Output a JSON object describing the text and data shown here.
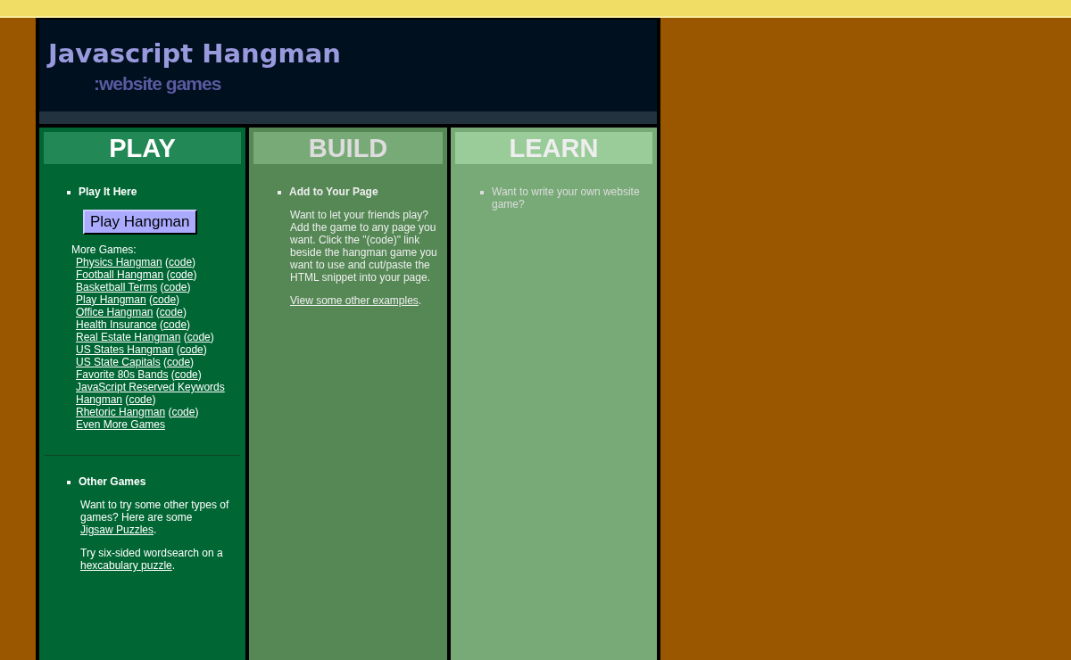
{
  "header": {
    "title": "Javascript Hangman",
    "subtitle": ":website games"
  },
  "play": {
    "heading": "PLAY",
    "section_title": "Play It Here",
    "button": "Play Hangman",
    "more_label": "More Games:",
    "games": [
      {
        "name": "Physics Hangman",
        "before_code": " (",
        "code": "code",
        "after_code": ")"
      },
      {
        "name": "Football Hangman",
        "before_code": " (",
        "code": "code",
        "after_code": ")"
      },
      {
        "name": "Basketball Terms",
        "before_code": " (",
        "code": "code",
        "after_code": ")"
      },
      {
        "name": "Play Hangman",
        "before_code": " (",
        "code": "code",
        "after_code": ")"
      },
      {
        "name": "Office Hangman",
        "before_code": " (",
        "code": "code",
        "after_code": ")"
      },
      {
        "name": "Health Insurance",
        "before_code": " (",
        "code": "code",
        "after_code": ")"
      },
      {
        "name": "Real Estate Hangman",
        "before_code": " (",
        "code": "code",
        "after_code": ")"
      },
      {
        "name": "US States Hangman",
        "before_code": " (",
        "code": "code",
        "after_code": ")"
      },
      {
        "name": "US State Capitals",
        "before_code": " (",
        "code": "code",
        "after_code": ")"
      },
      {
        "name": "Favorite 80s Bands",
        "before_code": " (",
        "code": "code",
        "after_code": ")"
      },
      {
        "name_lines": [
          "JavaScript Reserved Keywords",
          "Hangman"
        ],
        "before_code": " (",
        "code": "code",
        "after_code": ")"
      },
      {
        "name": "Rhetoric Hangman",
        "before_code": " (",
        "code": "code",
        "after_code": ")"
      },
      {
        "name": "Even More Games"
      }
    ],
    "other_title": "Other Games",
    "other_paragraphs": [
      {
        "before": "Want to try some other types of games? Here are some ",
        "link": "Jigsaw Puzzles",
        "after": "."
      },
      {
        "before": "Try six-sided wordsearch on a ",
        "link": "hexcabulary puzzle",
        "after": "."
      }
    ]
  },
  "build": {
    "heading": "BUILD",
    "section_title": "Add to Your Page",
    "text": "Want to let your friends play? Add the game to any page you want. Click the \"(code)\" link beside the hangman game you want to use and cut/paste the HTML snippet into your page.",
    "link_paragraph": {
      "link": "View some other examples",
      "after": "."
    }
  },
  "learn": {
    "heading": "LEARN",
    "items": [
      "Want to write your own website game?"
    ]
  }
}
